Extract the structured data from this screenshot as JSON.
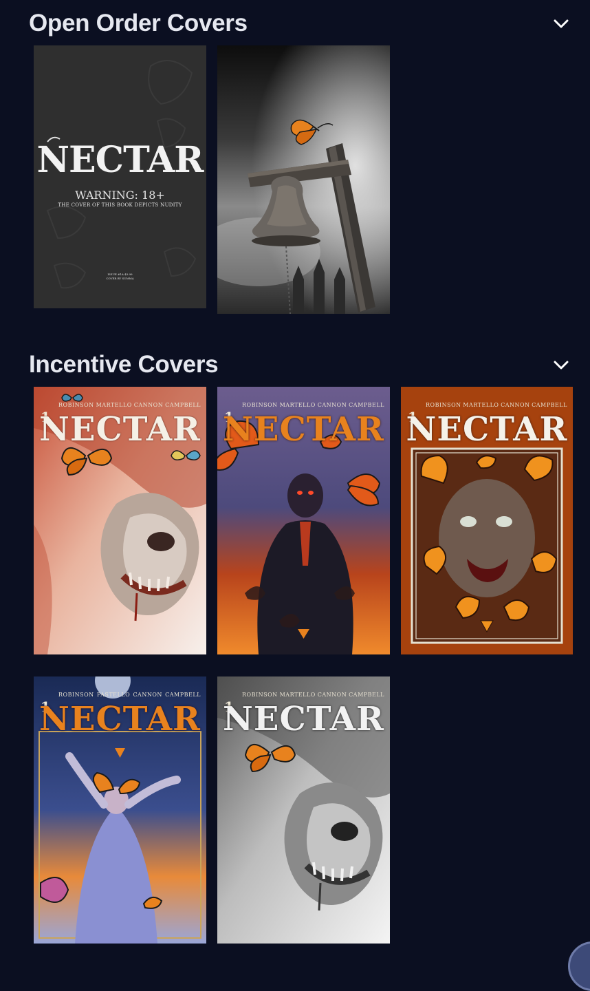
{
  "sections": [
    {
      "title": "Open Order Covers",
      "covers": [
        {
          "series_title": "NECTAR",
          "warning": "WARNING: 18+",
          "warning_note": "THE COVER OF THIS BOOK DEPICTS NUDITY",
          "fine_print_1": "ISSUE #1A $3.99",
          "fine_print_2": "COVER BY SUMMA"
        },
        {
          "series_title": ""
        }
      ]
    },
    {
      "title": "Incentive Covers",
      "covers": [
        {
          "series_title": "NECTAR",
          "issue": "1",
          "credits": [
            "ROBINSON",
            "MARTELLO",
            "CANNON",
            "CAMPBELL"
          ]
        },
        {
          "series_title": "NECTAR",
          "issue": "1",
          "credits": [
            "ROBINSON",
            "MARTELLO",
            "CANNON",
            "CAMPBELL"
          ]
        },
        {
          "series_title": "NECTAR",
          "issue": "1",
          "credits": [
            "ROBINSON",
            "MARTELLO",
            "CANNON",
            "CAMPBELL"
          ]
        },
        {
          "series_title": "NECTAR",
          "issue": "1",
          "credits": [
            "ROBINSON",
            "PASTELLO",
            "CANNON",
            "CAMPBELL"
          ]
        },
        {
          "series_title": "NECTAR",
          "issue": "1",
          "credits": [
            "ROBINSON",
            "MARTELLO",
            "CANNON",
            "CAMPBELL"
          ]
        }
      ]
    }
  ],
  "icons": {
    "collapse": "chevron-down-icon"
  },
  "colors": {
    "background": "#0b0f21",
    "heading": "#e6e8f0",
    "accent_orange": "#e8821e"
  }
}
